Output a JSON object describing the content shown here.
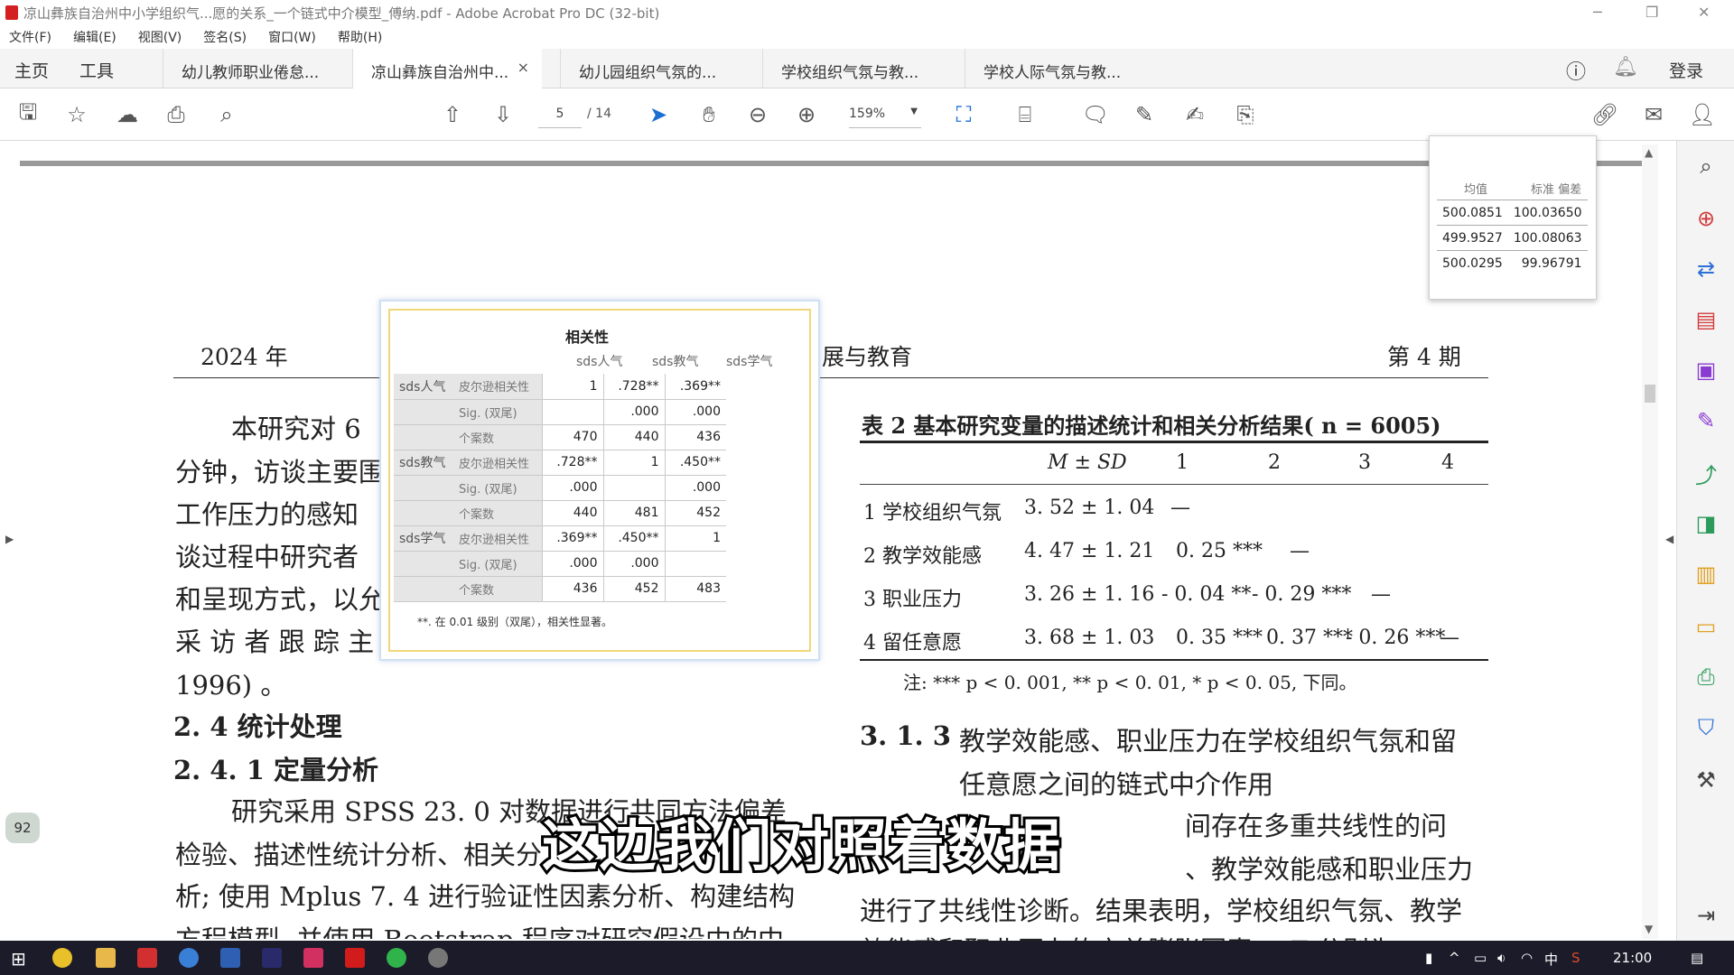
{
  "window": {
    "title": "凉山彝族自治州中小学组织气...愿的关系_一个链式中介模型_傅纳.pdf - Adobe Acrobat Pro DC (32-bit)"
  },
  "menu": [
    "文件(F)",
    "编辑(E)",
    "视图(V)",
    "签名(S)",
    "窗口(W)",
    "帮助(H)"
  ],
  "nav": {
    "home": "主页",
    "tools": "工具",
    "login": "登录"
  },
  "tabs": [
    {
      "label": "幼儿教师职业倦怠..."
    },
    {
      "label": "凉山彝族自治州中...",
      "close": "×"
    },
    {
      "label": "幼儿园组织气氛的..."
    },
    {
      "label": "学校组织气氛与教..."
    },
    {
      "label": "学校人际气氛与教..."
    }
  ],
  "toolbar": {
    "page_current": "5",
    "page_total": "/ 14",
    "zoom": "159%"
  },
  "page": {
    "year": "2024 年",
    "journal": "展与教育",
    "issue": "第 4 期",
    "left_lines": [
      "本研究对 6",
      "分钟，访谈主要围",
      "工作压力的感知",
      "谈过程中研究者",
      "和呈现方式，以允",
      "采 访 者 跟 踪 主 是",
      "1996) 。"
    ],
    "section_24": "2. 4    统计处理",
    "section_241": "2. 4. 1    定量分析",
    "para_lines": [
      "研究采用 SPSS 23. 0 对数据进行共同方法偏差",
      "检验、描述性统计分析、相关分",
      "析; 使用 Mplus 7. 4 进行验证性因素分析、构建结构",
      "方程模型, 并使用 Bootstrap 程序对研究假设中的中"
    ],
    "page_badge": "92",
    "section_311": "3. 1. 3",
    "section_311_title_1": "教学效能感、职业压力在学校组织气氛和留",
    "section_311_title_2": "任意愿之间的链式中介作用",
    "right_lines": [
      "间存在多重共线性的问",
      "、教学效能感和职业压力",
      "进行了共线性诊断。结果表明，学校组织气氛、教学",
      "效能感和职业压力的方差膨胀因素 VIF 分别为"
    ]
  },
  "table2": {
    "title": "表 2    基本研究变量的描述统计和相关分析结果( n = 6005)",
    "headers": [
      "M ± SD",
      "1",
      "2",
      "3",
      "4"
    ],
    "rows": [
      {
        "name": "1 学校组织气氛",
        "msd": "3. 52 ± 1. 04",
        "c1": "—",
        "c2": "",
        "c3": "",
        "c4": ""
      },
      {
        "name": "2 教学效能感",
        "msd": "4. 47 ± 1. 21",
        "c1": "0. 25 ***",
        "c2": "—",
        "c3": "",
        "c4": ""
      },
      {
        "name": "3 职业压力",
        "msd": "3. 26 ± 1. 16",
        "c1": "- 0. 04 **",
        "c2": "- 0. 29 ***",
        "c3": "—",
        "c4": ""
      },
      {
        "name": "4 留任意愿",
        "msd": "3. 68 ± 1. 03",
        "c1": "0. 35 ***",
        "c2": "0. 37 ***",
        "c3": "- 0. 26 ***",
        "c4": "—"
      }
    ],
    "note": "注: *** p < 0. 001, ** p < 0. 01, * p < 0. 05, 下同。"
  },
  "spss": {
    "title": "相关性",
    "col_headers": [
      "sds人气",
      "sds教气",
      "sds学气"
    ],
    "groups": [
      {
        "var": "sds人气",
        "rows": [
          {
            "stat": "皮尔逊相关性",
            "v": [
              "1",
              ".728**",
              ".369**"
            ]
          },
          {
            "stat": "Sig. (双尾)",
            "v": [
              "",
              ".000",
              ".000"
            ]
          },
          {
            "stat": "个案数",
            "v": [
              "470",
              "440",
              "436"
            ]
          }
        ]
      },
      {
        "var": "sds教气",
        "rows": [
          {
            "stat": "皮尔逊相关性",
            "v": [
              ".728**",
              "1",
              ".450**"
            ]
          },
          {
            "stat": "Sig. (双尾)",
            "v": [
              ".000",
              "",
              ".000"
            ]
          },
          {
            "stat": "个案数",
            "v": [
              "440",
              "481",
              "452"
            ]
          }
        ]
      },
      {
        "var": "sds学气",
        "rows": [
          {
            "stat": "皮尔逊相关性",
            "v": [
              ".369**",
              ".450**",
              "1"
            ]
          },
          {
            "stat": "Sig. (双尾)",
            "v": [
              ".000",
              ".000",
              ""
            ]
          },
          {
            "stat": "个案数",
            "v": [
              "436",
              "452",
              "483"
            ]
          }
        ]
      }
    ],
    "footnote": "**. 在 0.01 级别（双尾），相关性显著。"
  },
  "desc": {
    "headers": [
      "均值",
      "标准 偏差"
    ],
    "rows": [
      [
        "500.0851",
        "100.03650"
      ],
      [
        "499.9527",
        "100.08063"
      ],
      [
        "500.0295",
        "99.96791"
      ]
    ]
  },
  "subtitle": "这边我们对照着数据",
  "tray": {
    "time": "21:00",
    "ime": "中"
  }
}
